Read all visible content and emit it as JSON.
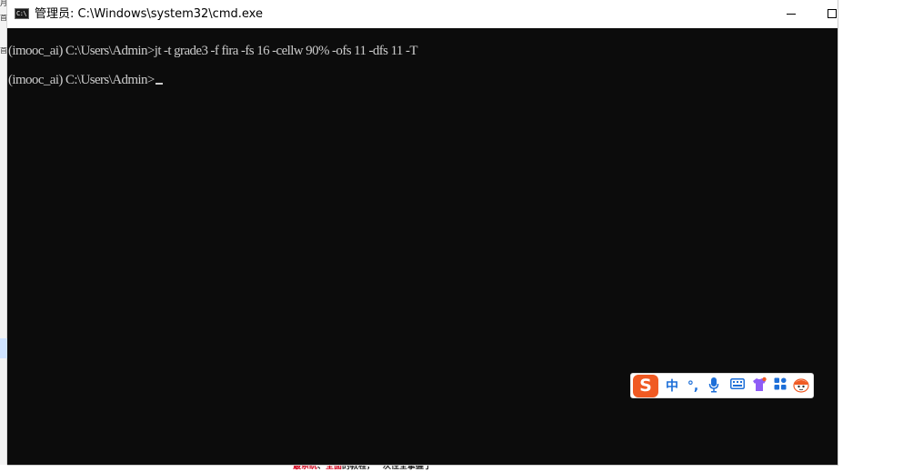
{
  "window": {
    "title": "管理员: C:\\Windows\\system32\\cmd.exe",
    "app_icon_text": "C:\\"
  },
  "console": {
    "lines": [
      "(imooc_ai) C:\\Users\\Admin>jt -t grade3 -f fira -fs 16 -cellw 90% -ofs 11 -dfs 11 -T",
      "(imooc_ai) C:\\Users\\Admin>"
    ]
  },
  "ime": {
    "logo": "S",
    "lang": "中",
    "punct": "°,"
  },
  "background": {
    "bottom_caption_red_1": "最系统",
    "bottom_caption_sep": "、",
    "bottom_caption_red_2": "全面",
    "bottom_caption_rest": "的教程，一次性全掌握了"
  },
  "colors": {
    "console_bg": "#0c0c0c",
    "console_text": "#cccccc",
    "ime_brand": "#f05a23",
    "ime_icon": "#1d6fd8"
  }
}
